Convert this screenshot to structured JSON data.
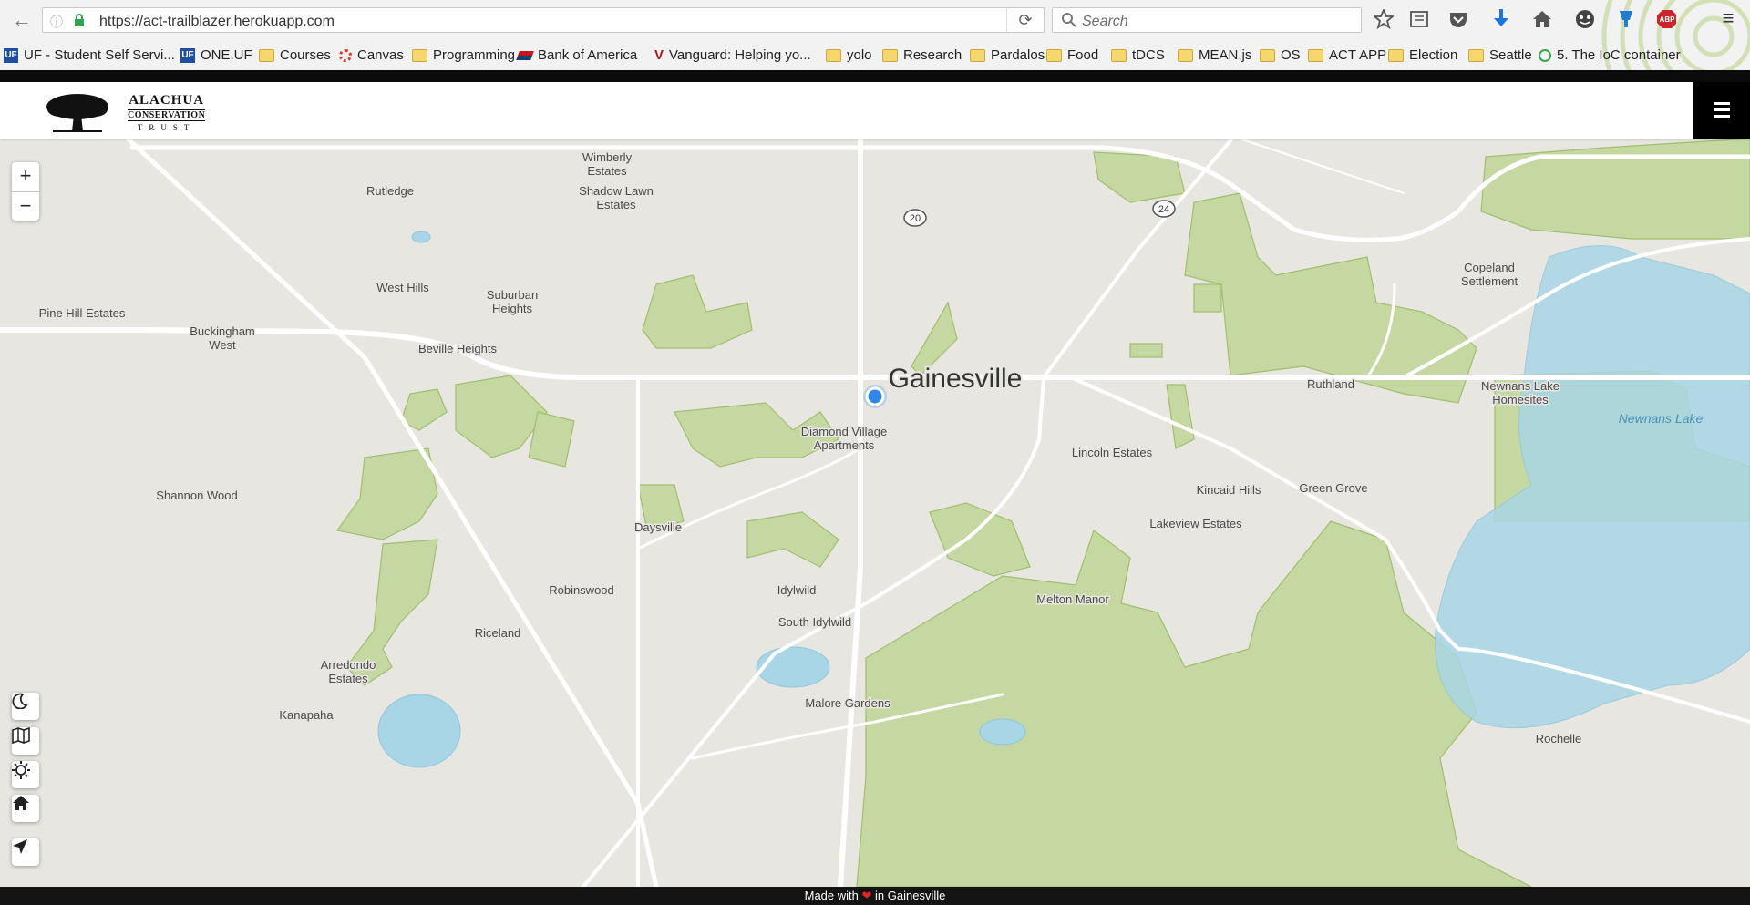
{
  "browser": {
    "url": "https://act-trailblazer.herokuapp.com",
    "search_placeholder": "Search",
    "bookmarks": [
      {
        "label": "UF - Student Self Servi...",
        "icon": "uf-icon"
      },
      {
        "label": "ONE.UF",
        "icon": "uf-icon"
      },
      {
        "label": "Courses",
        "icon": "folder-icon"
      },
      {
        "label": "Canvas",
        "icon": "canvas-icon"
      },
      {
        "label": "Programming",
        "icon": "folder-icon"
      },
      {
        "label": "Bank of America",
        "icon": "bofa-icon"
      },
      {
        "label": "Vanguard: Helping yo...",
        "icon": "vanguard-icon"
      },
      {
        "label": "yolo",
        "icon": "folder-icon"
      },
      {
        "label": "Research",
        "icon": "folder-icon"
      },
      {
        "label": "Pardalos",
        "icon": "folder-icon"
      },
      {
        "label": "Food",
        "icon": "folder-icon"
      },
      {
        "label": "tDCS",
        "icon": "folder-icon"
      },
      {
        "label": "MEAN.js",
        "icon": "folder-icon"
      },
      {
        "label": "OS",
        "icon": "folder-icon"
      },
      {
        "label": "ACT APP",
        "icon": "folder-icon"
      },
      {
        "label": "Election",
        "icon": "folder-icon"
      },
      {
        "label": "Seattle",
        "icon": "folder-icon"
      },
      {
        "label": "5. The IoC container",
        "icon": "page-icon"
      }
    ]
  },
  "app": {
    "logo": {
      "line1": "ALACHUA",
      "line2": "CONSERVATION",
      "line3": "TRUST"
    },
    "map_controls": {
      "zoom_in": "+",
      "zoom_out": "−"
    },
    "footer": {
      "prefix": "Made with",
      "heart": "❤",
      "suffix": "in Gainesville"
    }
  },
  "map": {
    "city_label": "Gainesville",
    "lake_label": "Newnans Lake",
    "road_shields": [
      "20",
      "24"
    ],
    "places": [
      [
        "Wimberly",
        "Estates"
      ],
      [
        "Shadow Lawn",
        "Estates"
      ],
      [
        "Rutledge"
      ],
      [
        "Copeland",
        "Settlement"
      ],
      [
        "Suburban",
        "Heights"
      ],
      [
        "West Hills"
      ],
      [
        "Pine Hill Estates"
      ],
      [
        "Buckingham",
        "West"
      ],
      [
        "Beville Heights"
      ],
      [
        "Ruthland"
      ],
      [
        "Newnans Lake",
        "Homesites"
      ],
      [
        "Diamond Village",
        "Apartments"
      ],
      [
        "Lincoln Estates"
      ],
      [
        "Kincaid Hills"
      ],
      [
        "Green Grove"
      ],
      [
        "Shannon Wood"
      ],
      [
        "Daysville"
      ],
      [
        "Lakeview Estates"
      ],
      [
        "Robinswood"
      ],
      [
        "Idylwild"
      ],
      [
        "Melton Manor"
      ],
      [
        "Riceland"
      ],
      [
        "South Idylwild"
      ],
      [
        "Arredondo",
        "Estates"
      ],
      [
        "Malore Gardens"
      ],
      [
        "Kanapaha"
      ],
      [
        "Rochelle"
      ]
    ]
  },
  "colors": {
    "park": "#c6d8a2",
    "park_edge": "#9fbf6c",
    "water": "#a9d6e6",
    "road": "#ffffff",
    "land": "#e8e6e1",
    "location": "#2f86e6"
  }
}
